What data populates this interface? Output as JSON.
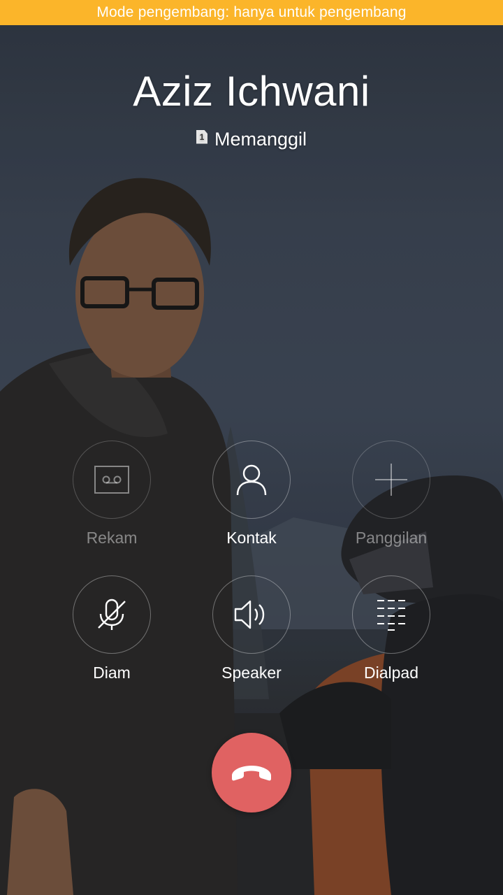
{
  "dev_banner": {
    "text": "Mode pengembang: hanya untuk pengembang",
    "color": "#fbb52a"
  },
  "call": {
    "caller_name": "Aziz Ichwani",
    "sim_slot": "1",
    "status": "Memanggil"
  },
  "controls": [
    {
      "id": "record",
      "label": "Rekam",
      "icon": "voicemail-tape-icon",
      "enabled": false
    },
    {
      "id": "contacts",
      "label": "Kontak",
      "icon": "person-icon",
      "enabled": true
    },
    {
      "id": "add_call",
      "label": "Panggilan",
      "icon": "plus-icon",
      "enabled": false
    },
    {
      "id": "mute",
      "label": "Diam",
      "icon": "mic-off-icon",
      "enabled": true
    },
    {
      "id": "speaker",
      "label": "Speaker",
      "icon": "speaker-icon",
      "enabled": true
    },
    {
      "id": "dialpad",
      "label": "Dialpad",
      "icon": "dialpad-icon",
      "enabled": true
    }
  ],
  "end_call": {
    "icon": "phone-hangup-icon",
    "color": "#e06262"
  }
}
